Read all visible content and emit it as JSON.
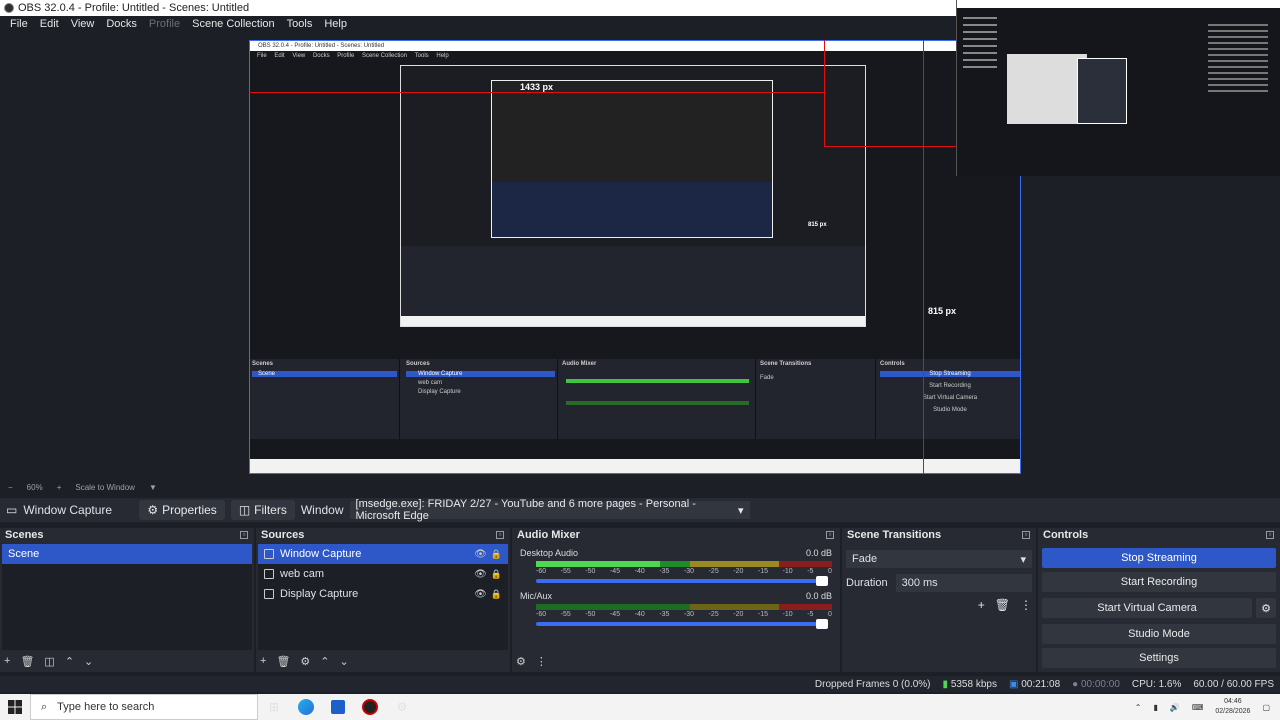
{
  "window": {
    "title": "OBS 32.0.4 - Profile: Untitled - Scenes: Untitled"
  },
  "menu": [
    "File",
    "Edit",
    "View",
    "Docks",
    "Profile",
    "Scene Collection",
    "Tools",
    "Help"
  ],
  "preview": {
    "measure_top": "1433 px",
    "measure_right": "815 px",
    "measure_inner": "815 px",
    "nested_title": "OBS 32.0.4 - Profile: Untitled - Scenes: Untitled",
    "nested_scene_label": "Scene",
    "nested_sources": [
      "Window Capture",
      "web cam",
      "Display Capture"
    ],
    "nested_buttons": [
      "Stop Streaming",
      "Start Recording",
      "Start Virtual Camera",
      "Studio Mode",
      "Settings"
    ]
  },
  "zoom": {
    "value": "60%",
    "label": "Scale to Window"
  },
  "sourcebar": {
    "current_source": "Window Capture",
    "properties_label": "Properties",
    "filters_label": "Filters",
    "window_label": "Window",
    "window_value": "[msedge.exe]: FRIDAY 2/27 - YouTube and 6 more pages - Personal - Microsoft Edge"
  },
  "scenes": {
    "title": "Scenes",
    "items": [
      "Scene"
    ]
  },
  "sources": {
    "title": "Sources",
    "items": [
      {
        "name": "Window Capture"
      },
      {
        "name": "web cam"
      },
      {
        "name": "Display Capture"
      }
    ]
  },
  "audio": {
    "title": "Audio Mixer",
    "channels": [
      {
        "name": "Desktop Audio",
        "db": "0.0 dB",
        "level": 0.42
      },
      {
        "name": "Mic/Aux",
        "db": "0.0 dB",
        "level": 0.0
      }
    ],
    "ticks": [
      "-60",
      "-55",
      "-50",
      "-45",
      "-40",
      "-35",
      "-30",
      "-25",
      "-20",
      "-15",
      "-10",
      "-5",
      "0"
    ]
  },
  "transitions": {
    "title": "Scene Transitions",
    "type": "Fade",
    "duration_label": "Duration",
    "duration_value": "300 ms"
  },
  "controls": {
    "title": "Controls",
    "stop_streaming": "Stop Streaming",
    "start_recording": "Start Recording",
    "start_virtual_camera": "Start Virtual Camera",
    "studio_mode": "Studio Mode",
    "settings": "Settings"
  },
  "status": {
    "dropped": "Dropped Frames 0 (0.0%)",
    "bitrate": "5358 kbps",
    "stream_time": "00:21:08",
    "rec_time": "00:00:00",
    "cpu": "CPU: 1.6%",
    "fps": "60.00 / 60.00 FPS"
  },
  "taskbar": {
    "search_placeholder": "Type here to search",
    "time": "04:46",
    "date": "02/28/2026"
  },
  "colors": {
    "accent": "#2e57c7",
    "background": "#1d1f26",
    "dock": "#272a33",
    "measure_line": "#e01010"
  }
}
